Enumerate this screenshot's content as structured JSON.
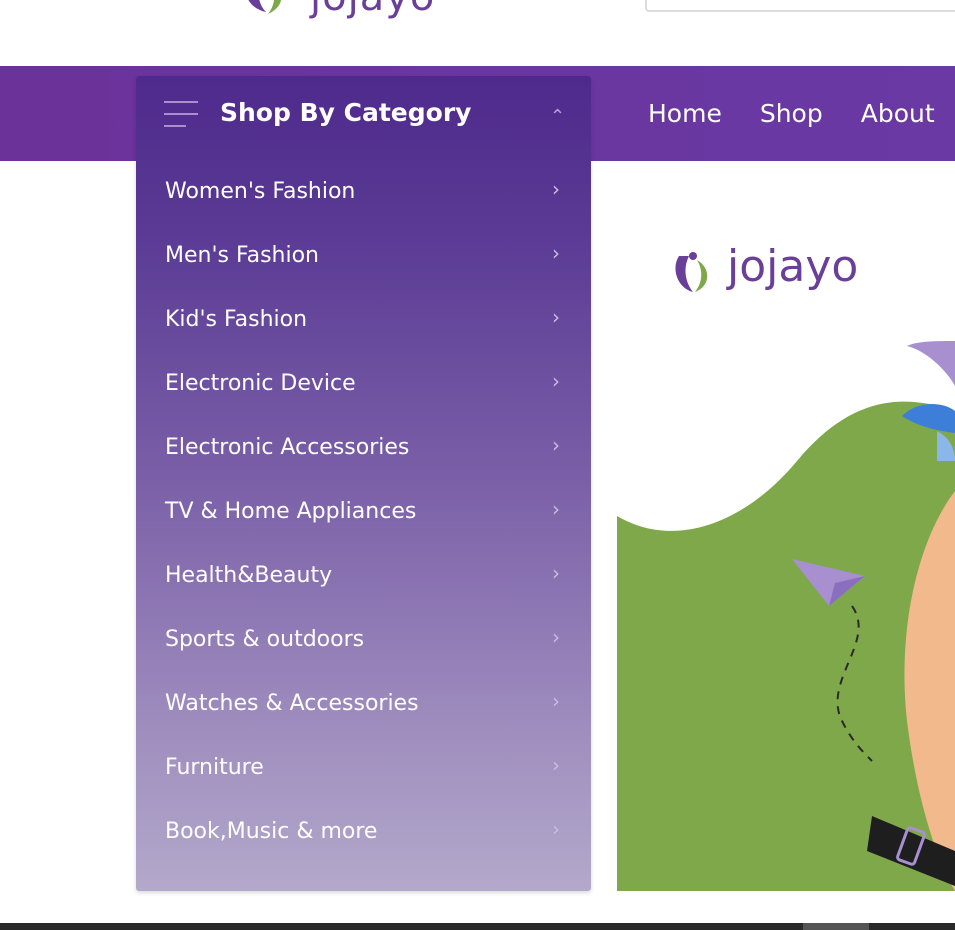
{
  "brand": {
    "name": "jojayo",
    "colors": {
      "primary": "#6a36a0",
      "accent": "#7fa84a",
      "logo_icon": "#6a3f9a"
    }
  },
  "header": {
    "logo_text": "jojayo",
    "search_placeholder": ""
  },
  "nav": {
    "links": [
      "Home",
      "Shop",
      "About"
    ]
  },
  "category_menu": {
    "title": "Shop By Category",
    "hamburger_icon": "menu-icon",
    "toggle_icon": "chevron-up-icon",
    "items": [
      {
        "label": "Women's Fashion",
        "icon": "chevron-right-icon"
      },
      {
        "label": "Men's Fashion",
        "icon": "chevron-right-icon"
      },
      {
        "label": "Kid's Fashion",
        "icon": "chevron-right-icon"
      },
      {
        "label": "Electronic Device",
        "icon": "chevron-right-icon"
      },
      {
        "label": "Electronic Accessories",
        "icon": "chevron-right-icon"
      },
      {
        "label": "TV & Home Appliances",
        "icon": "chevron-right-icon"
      },
      {
        "label": "Health&Beauty",
        "icon": "chevron-right-icon"
      },
      {
        "label": "Sports & outdoors",
        "icon": "chevron-right-icon"
      },
      {
        "label": "Watches & Accessories",
        "icon": "chevron-right-icon"
      },
      {
        "label": "Furniture",
        "icon": "chevron-right-icon"
      },
      {
        "label": "Book,Music & more",
        "icon": "chevron-right-icon"
      }
    ]
  },
  "hero": {
    "logo_text": "jojayo"
  }
}
